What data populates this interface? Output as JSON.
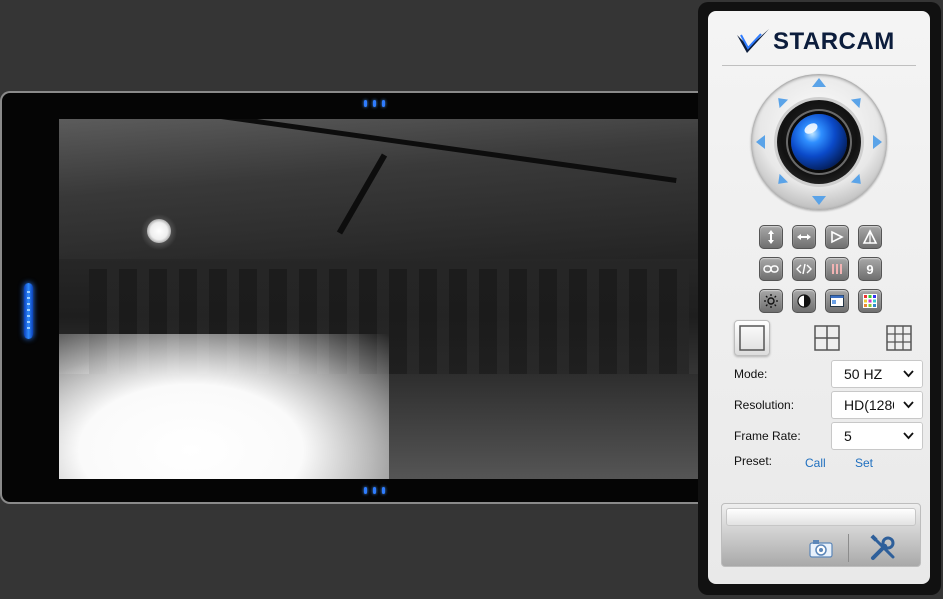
{
  "brand": {
    "name": "STARCAM",
    "accent": "#2f7cff"
  },
  "ptz": {
    "controls": [
      "arrow-up",
      "arrow-down",
      "arrow-left",
      "arrow-right",
      "arrow-up-left",
      "arrow-up-right",
      "arrow-down-left",
      "arrow-down-right"
    ]
  },
  "tool_buttons": [
    {
      "icon": "vertical-patrol-icon",
      "text": ""
    },
    {
      "icon": "horizontal-patrol-icon",
      "text": ""
    },
    {
      "icon": "play-icon",
      "text": ""
    },
    {
      "icon": "flip-icon",
      "text": ""
    },
    {
      "icon": "link-icon",
      "text": ""
    },
    {
      "icon": "code-icon",
      "text": ""
    },
    {
      "icon": "bars-icon",
      "text": ""
    },
    {
      "icon": "preset-number-icon",
      "text": "9"
    },
    {
      "icon": "brightness-icon",
      "text": ""
    },
    {
      "icon": "contrast-icon",
      "text": ""
    },
    {
      "icon": "window-icon",
      "text": ""
    },
    {
      "icon": "color-grid-icon",
      "text": ""
    }
  ],
  "layouts": [
    "single-view",
    "four-view",
    "nine-view"
  ],
  "settings": {
    "mode": {
      "label": "Mode:",
      "value": "50 HZ"
    },
    "resolution": {
      "label": "Resolution:",
      "value": "HD(1280"
    },
    "frame_rate": {
      "label": "Frame Rate:",
      "value": "5"
    }
  },
  "preset": {
    "label": "Preset:",
    "call": "Call",
    "set": "Set"
  },
  "bottom_icons": [
    "camera-icon",
    "tools-icon"
  ]
}
